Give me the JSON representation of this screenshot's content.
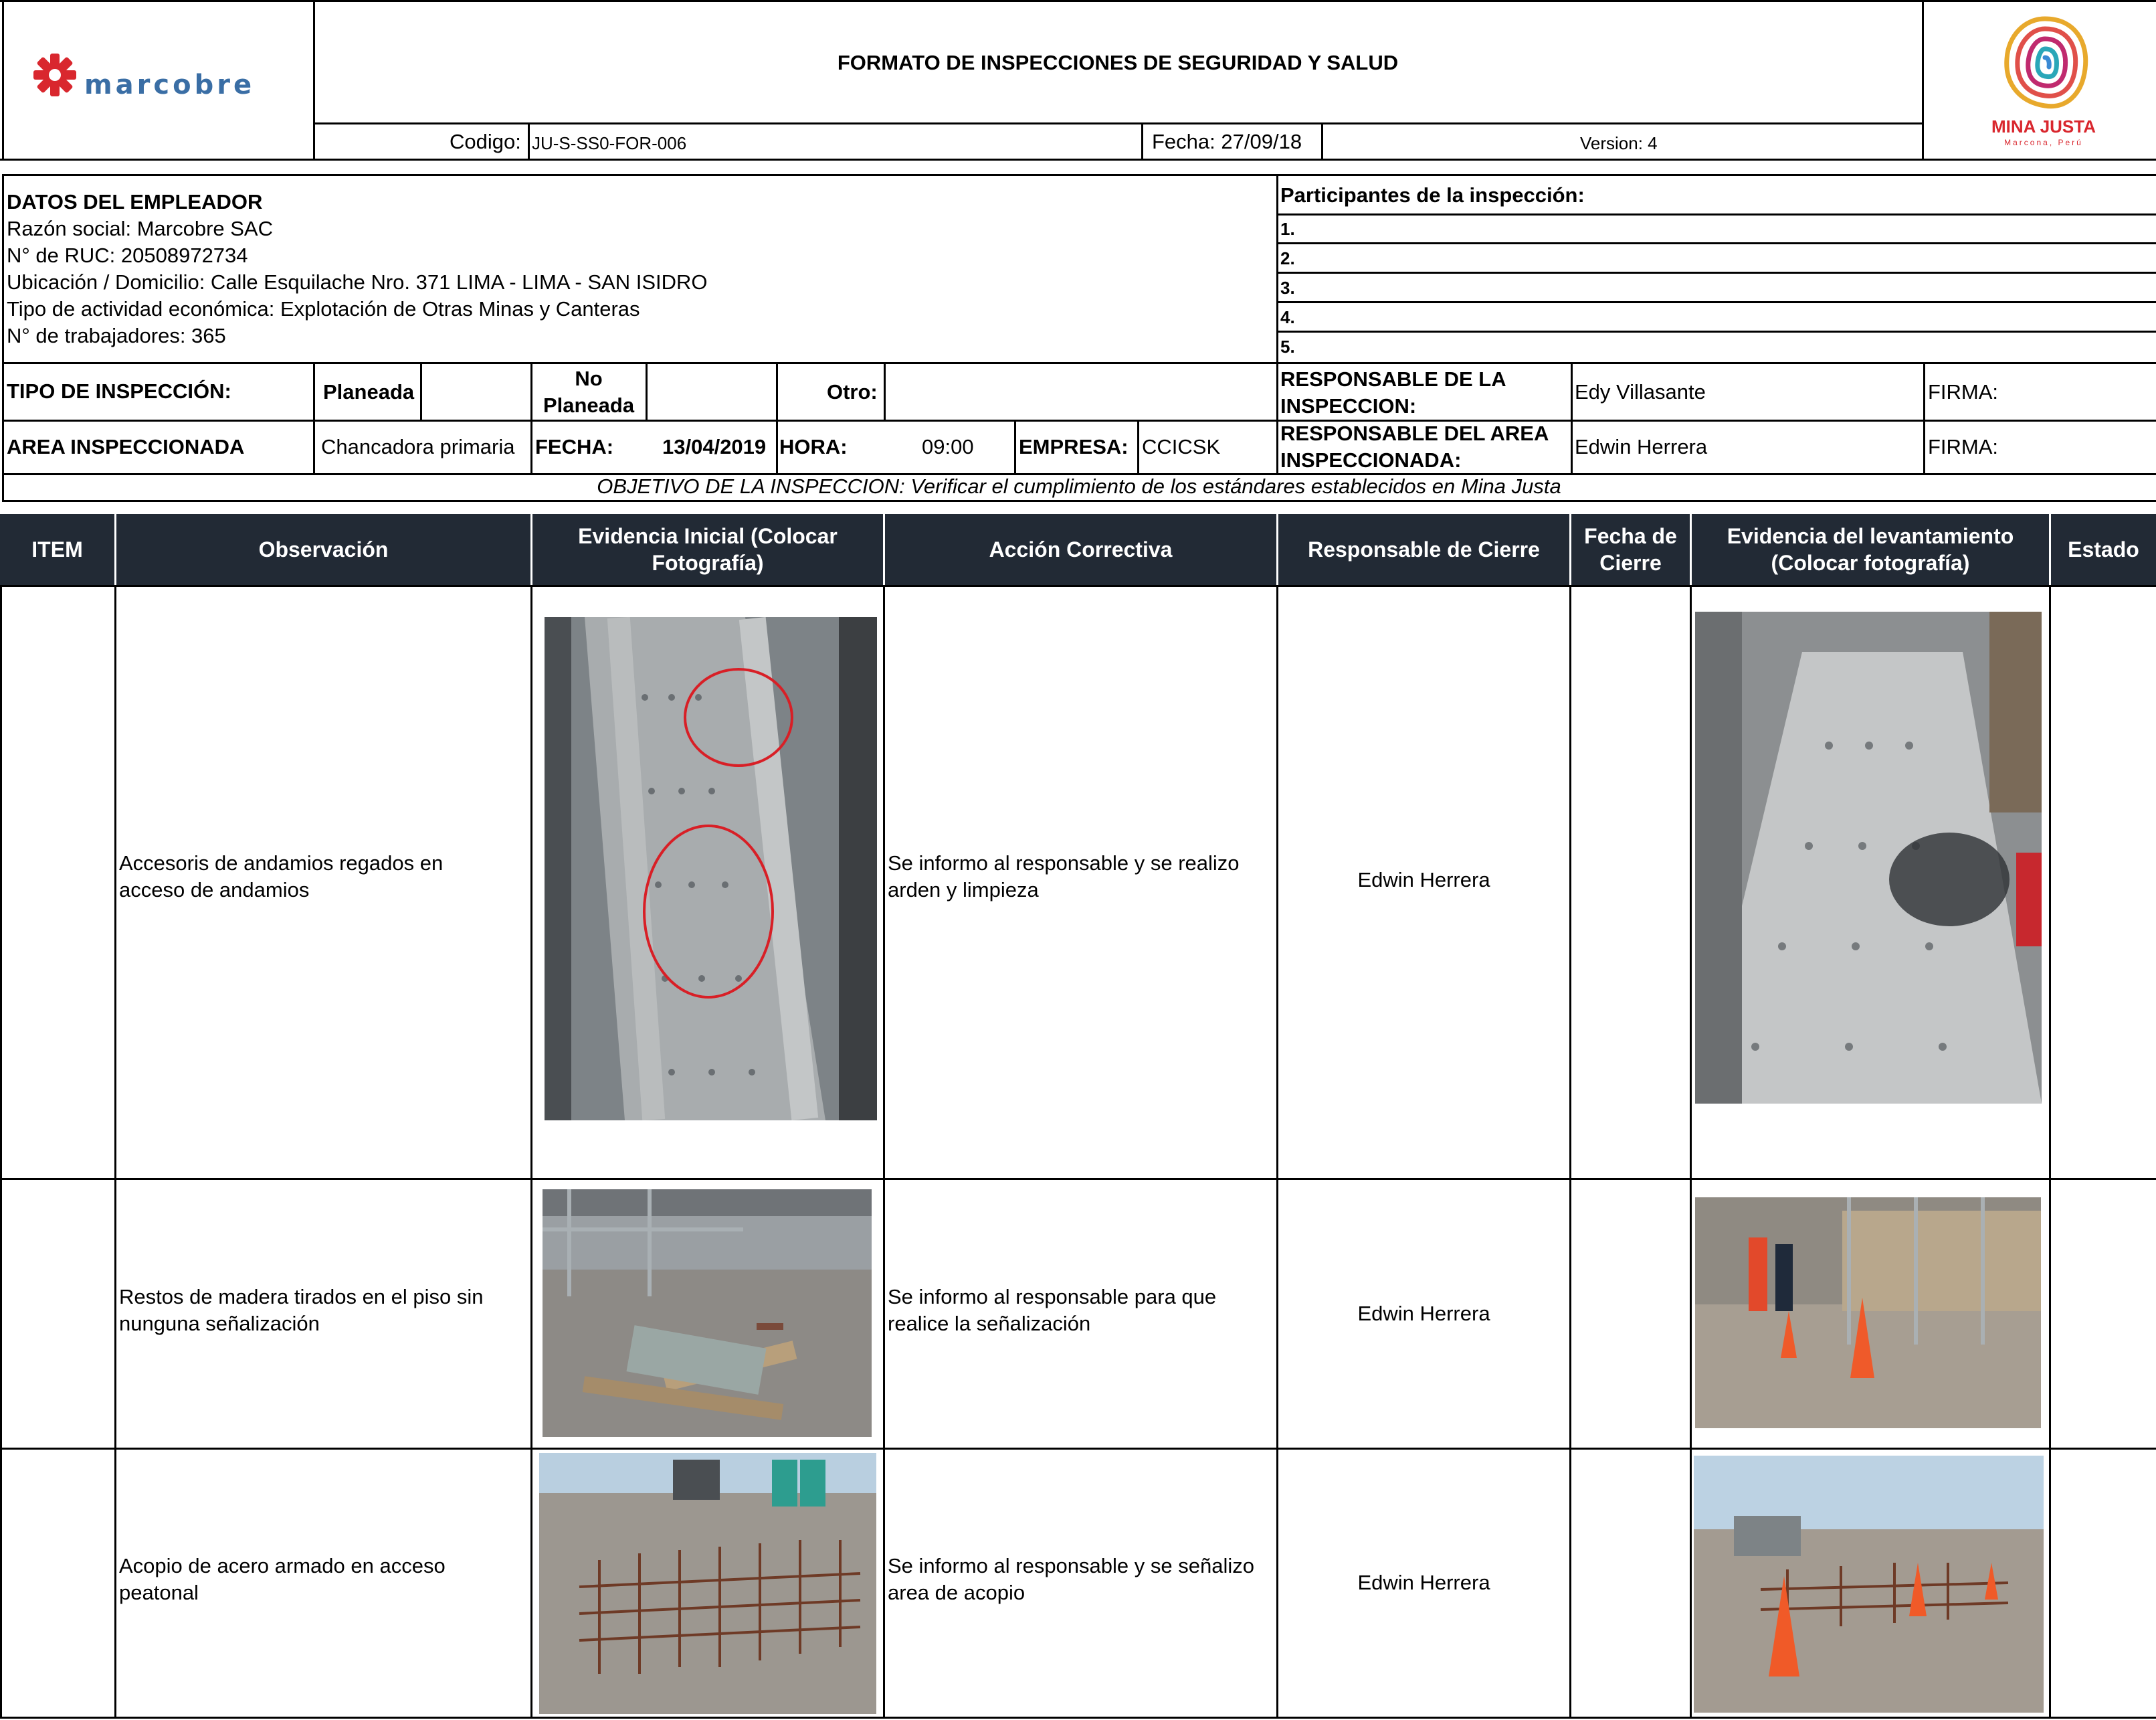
{
  "header": {
    "company_logo_text": "marcobre",
    "form_title": "FORMATO DE INSPECCIONES  DE SEGURIDAD Y SALUD",
    "codigo_label": "Codigo:",
    "codigo_value": "JU-S-SS0-FOR-006",
    "fecha_label": "Fecha: 27/09/18",
    "version_label": "Version: 4",
    "brand_logo_name": "MINA JUSTA",
    "brand_logo_sub": "Marcona, Perú"
  },
  "employer": {
    "title": "DATOS DEL EMPLEADOR",
    "lines": [
      "Razón social:  Marcobre SAC",
      "N° de RUC: 20508972734",
      "Ubicación / Domicilio:   Calle Esquilache Nro. 371 LIMA - LIMA - SAN ISIDRO",
      "Tipo de actividad económica:  Explotación de Otras Minas y Canteras",
      "N° de trabajadores: 365"
    ]
  },
  "participants": {
    "title": "Participantes de la inspección:",
    "items": [
      "1.",
      "2.",
      "3.",
      "4.",
      "5."
    ]
  },
  "inspection": {
    "tipo_label": "TIPO DE INSPECCIÓN:",
    "planeada": "Planeada",
    "no_planeada_1": "No",
    "no_planeada_2": "Planeada",
    "otro": "Otro:",
    "area_label": "AREA INSPECCIONADA",
    "area_value": "Chancadora primaria",
    "fecha_label": "FECHA:",
    "fecha_value": "13/04/2019",
    "hora_label": "HORA:",
    "hora_value": "09:00",
    "empresa_label": "EMPRESA:",
    "empresa_value": "CCICSK",
    "resp_insp_1": "RESPONSABLE DE LA",
    "resp_insp_2": "INSPECCION:",
    "resp_insp_value": "Edy Villasante",
    "resp_area_1": "RESPONSABLE DEL AREA",
    "resp_area_2": "INSPECCIONADA:",
    "resp_area_value": "Edwin Herrera",
    "firma": "FIRMA:",
    "objetivo": "OBJETIVO DE LA INSPECCION: Verificar el cumplimiento de los estándares  establecidos en Mina Justa"
  },
  "table": {
    "headers": {
      "item": "ITEM",
      "observacion": "Observación",
      "evidencia_inicial_1": "Evidencia Inicial (Colocar",
      "evidencia_inicial_2": "Fotografía)",
      "accion": "Acción Correctiva",
      "responsable": "Responsable de Cierre",
      "fecha_1": "Fecha de",
      "fecha_2": "Cierre",
      "evidencia_lev_1": "Evidencia del levantamiento",
      "evidencia_lev_2": "(Colocar fotografía)",
      "estado": "Estado"
    },
    "rows": [
      {
        "obs_1": "Accesoris de andamios regados en",
        "obs_2": "acceso de andamios",
        "acc_1": "Se informo al responsable y se realizo",
        "acc_2": "arden y limpieza",
        "responsable": "Edwin Herrera"
      },
      {
        "obs_1": "Restos de madera tirados en el piso sin",
        "obs_2": "nunguna señalización",
        "acc_1": "Se informo al responsable para que",
        "acc_2": "realice la señalización",
        "responsable": "Edwin Herrera"
      },
      {
        "obs_1": "Acopio de acero armado en acceso",
        "obs_2": "peatonal",
        "acc_1": "Se informo al responsable y se señalizo",
        "acc_2": "area de acopio",
        "responsable": "Edwin Herrera"
      }
    ]
  },
  "colors": {
    "header_band": "#222a35",
    "logo_red": "#d9272e",
    "logo_blue": "#3a6ea5"
  }
}
